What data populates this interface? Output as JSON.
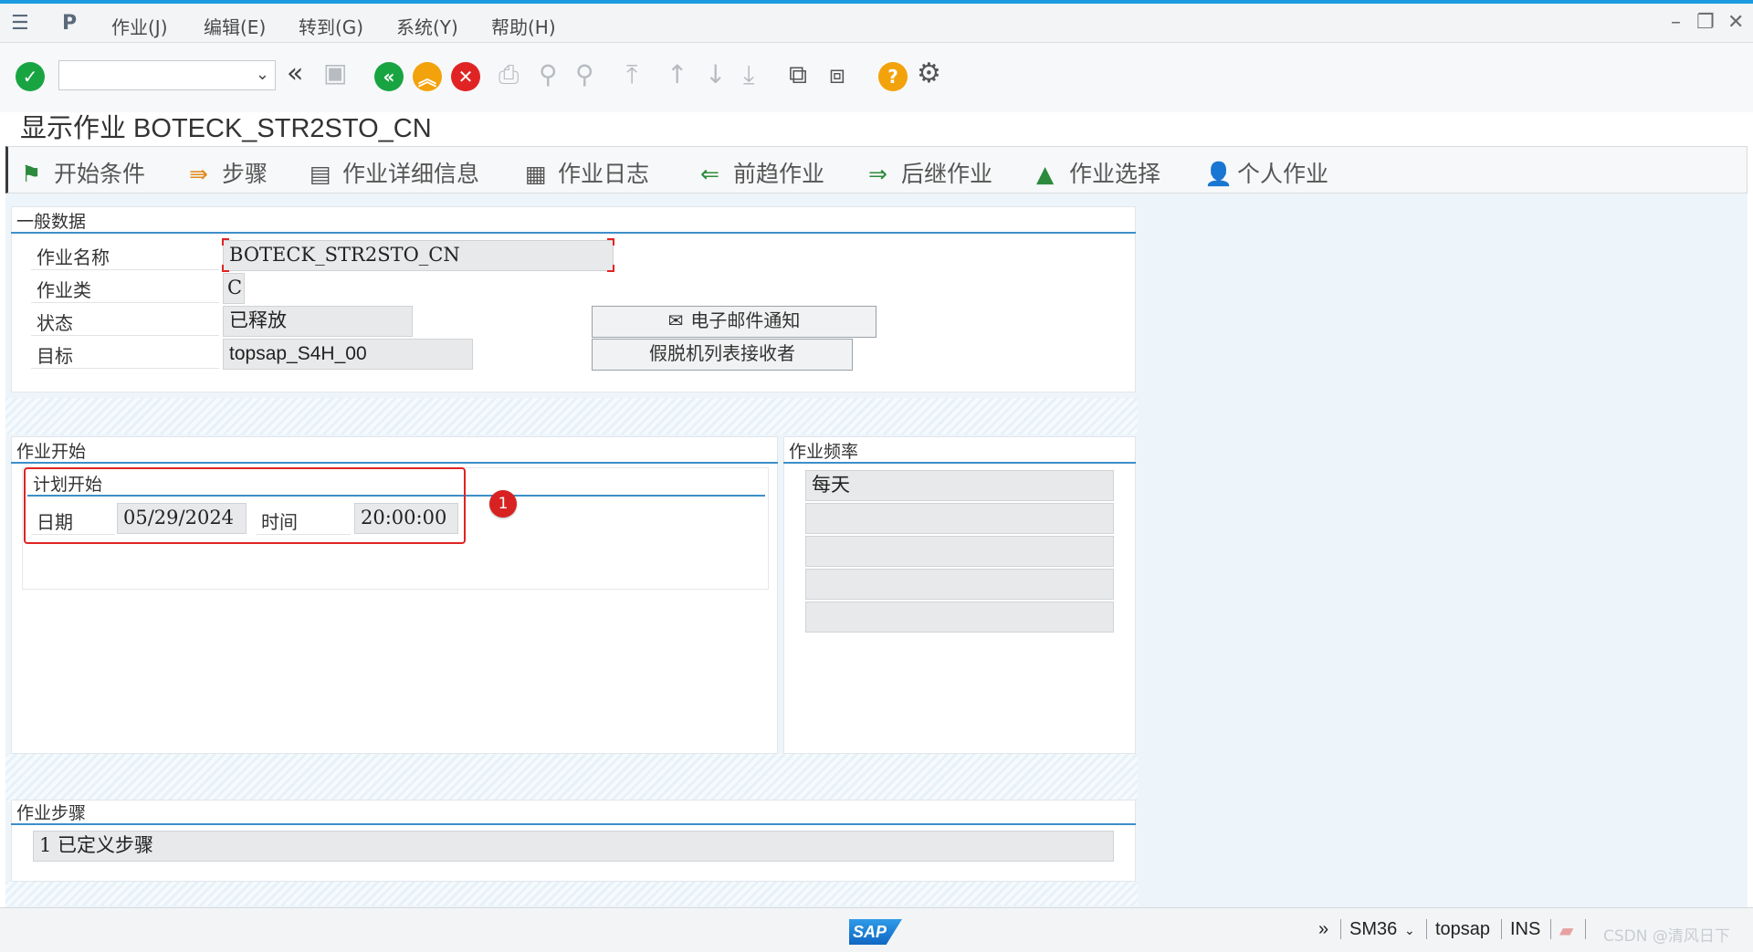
{
  "menubar": {
    "items": [
      "作业(J)",
      "编辑(E)",
      "转到(G)",
      "系统(Y)",
      "帮助(H)"
    ]
  },
  "toolbar": {
    "command_value": "",
    "icons": [
      "enter-icon",
      "back-icon",
      "exit-icon",
      "cancel-icon",
      "save-icon",
      "print-icon",
      "find-icon",
      "find-next-icon",
      "first-page-icon",
      "prev-page-icon",
      "next-page-icon",
      "last-page-icon",
      "new-session-icon",
      "shortcut-icon",
      "help-icon",
      "settings-icon"
    ]
  },
  "page": {
    "title": "显示作业 BOTECK_STR2STO_CN"
  },
  "apptoolbar": {
    "start_condition": "开始条件",
    "steps": "步骤",
    "job_details": "作业详细信息",
    "job_log": "作业日志",
    "predecessor": "前趋作业",
    "successor": "后继作业",
    "job_selection": "作业选择",
    "own_jobs": "个人作业"
  },
  "general": {
    "title": "一般数据",
    "job_name_label": "作业名称",
    "job_name": "BOTECK_STR2STO_CN",
    "job_class_label": "作业类",
    "job_class": "C",
    "status_label": "状态",
    "status": "已释放",
    "target_label": "目标",
    "target": "topsap_S4H_00",
    "email_button": "电子邮件通知",
    "spool_button": "假脱机列表接收者"
  },
  "job_start": {
    "title": "作业开始",
    "planned_title": "计划开始",
    "date_label": "日期",
    "date": "05/29/2024",
    "time_label": "时间",
    "time": "20:00:00",
    "badge": "1"
  },
  "frequency": {
    "title": "作业频率",
    "values": [
      "每天",
      "",
      "",
      "",
      ""
    ]
  },
  "steps": {
    "title": "作业步骤",
    "value": "1  已定义步骤"
  },
  "statusbar": {
    "logo": "SAP",
    "chevron": "»",
    "transaction": "SM36",
    "user": "topsap",
    "mode": "INS",
    "watermark": "CSDN @清风日下"
  },
  "colors": {
    "accent": "#1a9be0",
    "green": "#19a442",
    "orange": "#f2a20a",
    "red": "#e02424"
  }
}
